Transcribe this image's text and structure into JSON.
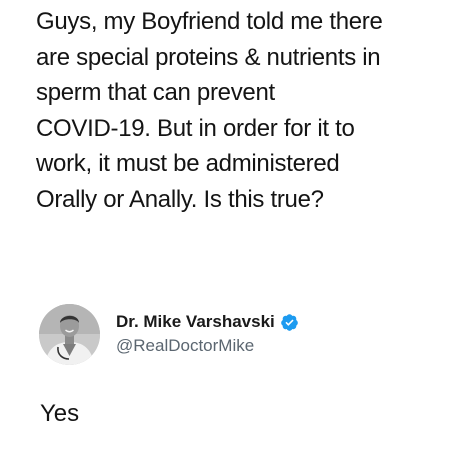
{
  "post": {
    "lines": [
      "Guys, my Boyfriend told me there",
      "are special proteins & nutrients in",
      "sperm that can prevent",
      "COVID-19. But in order for it to",
      "work, it must be administered",
      "Orally or Anally. Is this true?"
    ]
  },
  "reply": {
    "display_name": "Dr. Mike Varshavski",
    "handle": "@RealDoctorMike",
    "verified": true,
    "verified_icon": "verified-badge-icon",
    "avatar_icon": "profile-avatar",
    "text": "Yes"
  },
  "colors": {
    "text": "#141414",
    "handle": "#5b6670",
    "verified_badge": "#1d9bf0",
    "background": "#ffffff"
  }
}
